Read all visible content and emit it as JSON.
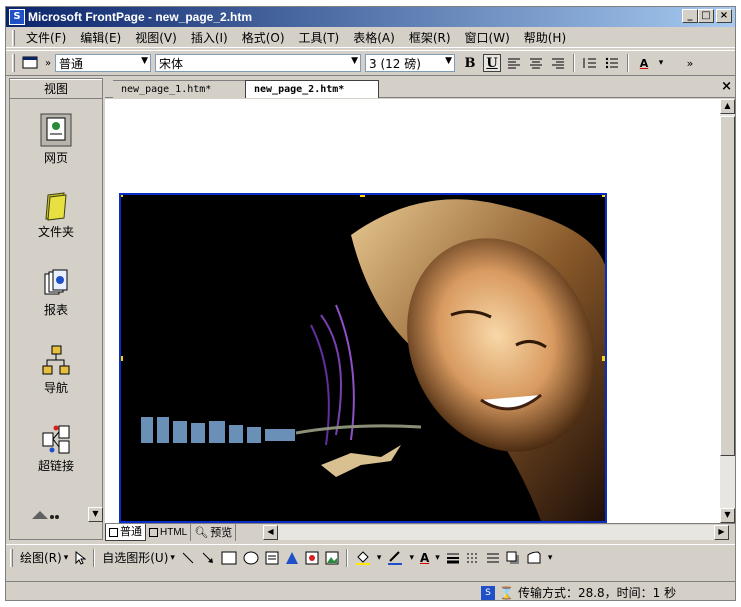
{
  "window": {
    "title": "Microsoft FrontPage - new_page_2.htm",
    "minimize": "_",
    "maximize": "□",
    "close": "×"
  },
  "menu": [
    "文件(F)",
    "编辑(E)",
    "视图(V)",
    "插入(I)",
    "格式(O)",
    "工具(T)",
    "表格(A)",
    "框架(R)",
    "窗口(W)",
    "帮助(H)"
  ],
  "toolbar": {
    "style_value": "普通",
    "font_value": "宋体",
    "size_value": "3  (12 磅)",
    "bold": "B",
    "underline": "U",
    "more": "»"
  },
  "views_panel": {
    "header": "视图",
    "items": [
      {
        "label": "网页",
        "icon": "page-view-icon"
      },
      {
        "label": "文件夹",
        "icon": "folder-view-icon"
      },
      {
        "label": "报表",
        "icon": "reports-view-icon"
      },
      {
        "label": "导航",
        "icon": "navigation-view-icon"
      },
      {
        "label": "超链接",
        "icon": "hyperlinks-view-icon"
      }
    ]
  },
  "tabs": {
    "items": [
      "new_page_1.htm*",
      "new_page_2.htm*"
    ],
    "active_index": 1,
    "close": "×"
  },
  "view_tabs": [
    "普通",
    "HTML",
    "预览"
  ],
  "drawing_toolbar": {
    "draw_label": "绘图(R)",
    "autoshapes_label": "自选图形(U)"
  },
  "status": {
    "text": "传输方式：28.8，时间：1 秒"
  },
  "colors": {
    "titlebar_start": "#0a246a",
    "titlebar_end": "#a6caf0",
    "selection_border": "#0a2cc8",
    "chrome": "#d4d0c8"
  }
}
